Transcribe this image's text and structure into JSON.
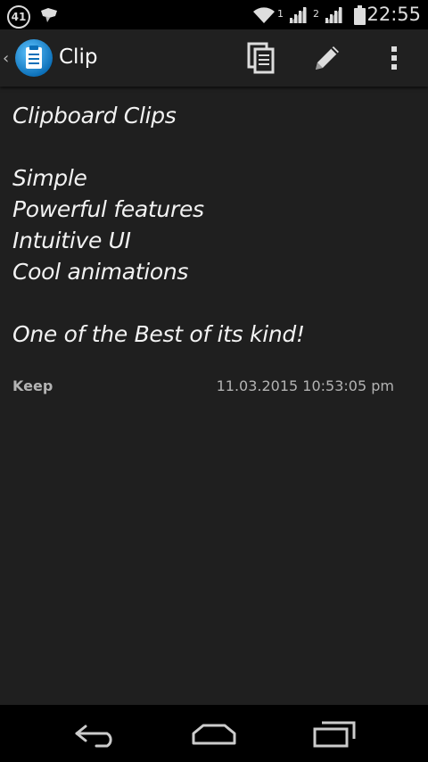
{
  "status_bar": {
    "notification_count": "41",
    "sim1_label": "1",
    "sim2_label": "2",
    "time": "22:55",
    "icons": [
      "notification-icon",
      "wifi-icon",
      "signal-icon",
      "signal-icon",
      "battery-icon"
    ]
  },
  "action_bar": {
    "title": "Clip",
    "actions": [
      "copy-icon",
      "edit-icon",
      "overflow-menu-icon"
    ]
  },
  "clip": {
    "lines": [
      "Clipboard Clips",
      "",
      "Simple",
      "Powerful features",
      "Intuitive UI",
      "Cool animations",
      "",
      "One of the Best of its kind!"
    ],
    "label": "Keep",
    "timestamp": "11.03.2015  10:53:05 pm"
  },
  "colors": {
    "background": "#1f1f1f",
    "action_bar": "#202020",
    "status_bar": "#000000",
    "logo_blue": "#1a8fd8",
    "meta_text": "#b3b3b3"
  }
}
